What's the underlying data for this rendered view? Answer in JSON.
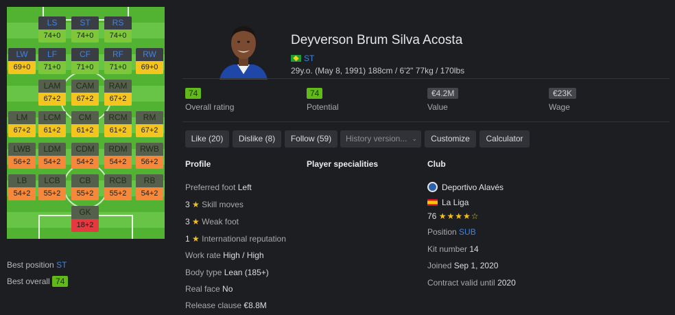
{
  "pitch": {
    "positions": [
      {
        "name": "LS",
        "value": "74+0",
        "color": "green",
        "dim": false
      },
      {
        "name": "ST",
        "value": "74+0",
        "color": "green",
        "dim": false
      },
      {
        "name": "RS",
        "value": "74+0",
        "color": "green",
        "dim": false
      },
      {
        "name": "LW",
        "value": "69+0",
        "color": "yellow",
        "dim": false
      },
      {
        "name": "LF",
        "value": "71+0",
        "color": "green",
        "dim": false
      },
      {
        "name": "CF",
        "value": "71+0",
        "color": "green",
        "dim": false
      },
      {
        "name": "RF",
        "value": "71+0",
        "color": "green",
        "dim": false
      },
      {
        "name": "RW",
        "value": "69+0",
        "color": "yellow",
        "dim": false
      },
      {
        "name": "LAM",
        "value": "67+2",
        "color": "yellow",
        "dim": true
      },
      {
        "name": "CAM",
        "value": "67+2",
        "color": "yellow",
        "dim": true
      },
      {
        "name": "RAM",
        "value": "67+2",
        "color": "yellow",
        "dim": true
      },
      {
        "name": "LM",
        "value": "67+2",
        "color": "yellow",
        "dim": true
      },
      {
        "name": "LCM",
        "value": "61+2",
        "color": "yellow",
        "dim": true
      },
      {
        "name": "CM",
        "value": "61+2",
        "color": "yellow",
        "dim": true
      },
      {
        "name": "RCM",
        "value": "61+2",
        "color": "yellow",
        "dim": true
      },
      {
        "name": "RM",
        "value": "67+2",
        "color": "yellow",
        "dim": true
      },
      {
        "name": "LWB",
        "value": "56+2",
        "color": "orange",
        "dim": true
      },
      {
        "name": "LDM",
        "value": "54+2",
        "color": "orange",
        "dim": true
      },
      {
        "name": "CDM",
        "value": "54+2",
        "color": "orange",
        "dim": true
      },
      {
        "name": "RDM",
        "value": "54+2",
        "color": "orange",
        "dim": true
      },
      {
        "name": "RWB",
        "value": "56+2",
        "color": "orange",
        "dim": true
      },
      {
        "name": "LB",
        "value": "54+2",
        "color": "orange",
        "dim": true
      },
      {
        "name": "LCB",
        "value": "55+2",
        "color": "orange",
        "dim": true
      },
      {
        "name": "CB",
        "value": "55+2",
        "color": "orange",
        "dim": true
      },
      {
        "name": "RCB",
        "value": "55+2",
        "color": "orange",
        "dim": true
      },
      {
        "name": "RB",
        "value": "54+2",
        "color": "orange",
        "dim": true
      },
      {
        "name": "GK",
        "value": "18+2",
        "color": "red",
        "dim": true
      }
    ]
  },
  "side": {
    "best_position_label": "Best position",
    "best_position_value": "ST",
    "best_overall_label": "Best overall",
    "best_overall_value": "74"
  },
  "player": {
    "name": "Deyverson Brum Silva Acosta",
    "flag_icon": "brazil-flag",
    "position": "ST",
    "bio": "29y.o. (May 8, 1991) 188cm / 6'2\" 77kg / 170lbs"
  },
  "stats": [
    {
      "value": "74",
      "label": "Overall rating",
      "style": "green"
    },
    {
      "value": "74",
      "label": "Potential",
      "style": "green"
    },
    {
      "value": "€4.2M",
      "label": "Value",
      "style": "gray"
    },
    {
      "value": "€23K",
      "label": "Wage",
      "style": "gray"
    }
  ],
  "buttons": {
    "like": "Like (20)",
    "dislike": "Dislike (8)",
    "follow": "Follow (59)",
    "history": "History version...",
    "customize": "Customize",
    "calculator": "Calculator"
  },
  "profile": {
    "title": "Profile",
    "preferred_foot_label": "Preferred foot",
    "preferred_foot": "Left",
    "skill_moves": "3",
    "skill_moves_label": "Skill moves",
    "weak_foot": "3",
    "weak_foot_label": "Weak foot",
    "intl_rep": "1",
    "intl_rep_label": "International reputation",
    "work_rate_label": "Work rate",
    "work_rate": "High / High",
    "body_type_label": "Body type",
    "body_type": "Lean (185+)",
    "real_face_label": "Real face",
    "real_face": "No",
    "release_clause_label": "Release clause",
    "release_clause": "€8.8M"
  },
  "specialities": {
    "title": "Player specialities"
  },
  "club": {
    "title": "Club",
    "club_name": "Deportivo Alavés",
    "league": "La Liga",
    "rating": "76",
    "stars": "★★★★☆",
    "position_label": "Position",
    "position": "SUB",
    "kit_label": "Kit number",
    "kit": "14",
    "joined_label": "Joined",
    "joined": "Sep 1, 2020",
    "contract_label": "Contract valid until",
    "contract": "2020"
  },
  "colors": {
    "accent_blue": "#3f84e5",
    "rating_green": "#61b91a",
    "star_yellow": "#f2c21b",
    "background": "#1d1e22"
  }
}
